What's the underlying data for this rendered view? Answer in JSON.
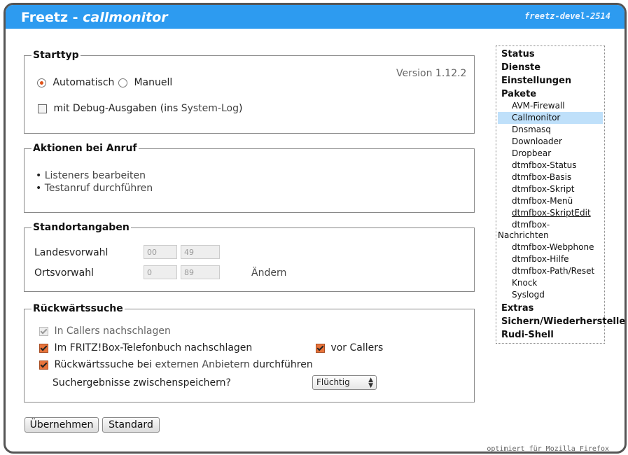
{
  "header": {
    "title_prefix": "Freetz - ",
    "title_page": "callmonitor",
    "build": "freetz-devel-2514"
  },
  "starttyp": {
    "legend": "Starttyp",
    "version": "Version 1.12.2",
    "auto_label": "Automatisch",
    "auto_checked": true,
    "manual_label": "Manuell",
    "manual_checked": false,
    "debug_label_prefix": "mit Debug-Ausgaben (ins ",
    "debug_link": "System-Log",
    "debug_label_suffix": ")",
    "debug_checked": false
  },
  "aktionen": {
    "legend": "Aktionen bei Anruf",
    "items": [
      "Listeners bearbeiten",
      "Testanruf durchführen"
    ]
  },
  "standort": {
    "legend": "Standortangaben",
    "landes_label": "Landesvorwahl",
    "landes_prefix": "00",
    "landes_value": "49",
    "orts_label": "Ortsvorwahl",
    "orts_prefix": "0",
    "orts_value": "89",
    "aendern_label": "Ändern"
  },
  "rueckwaerts": {
    "legend": "Rückwärtssuche",
    "callers_prefix": "In ",
    "callers_link": "Callers",
    "callers_suffix": " nachschlagen",
    "callers_checked": true,
    "callers_disabled": true,
    "fritzbox_label": "Im FRITZ!Box-Telefonbuch nachschlagen",
    "fritzbox_checked": true,
    "vor_callers_label": "vor Callers",
    "vor_callers_checked": true,
    "extern_prefix": "Rückwärtssuche bei ",
    "extern_link": "externen Anbietern",
    "extern_suffix": " durchführen",
    "extern_checked": true,
    "cache_label": "Suchergebnisse zwischenspeichern?",
    "cache_value": "Flüchtig"
  },
  "buttons": {
    "apply": "Übernehmen",
    "default": "Standard"
  },
  "menu": {
    "categories": {
      "status": "Status",
      "dienste": "Dienste",
      "einstellungen": "Einstellungen",
      "pakete": "Pakete",
      "extras": "Extras",
      "sichern": "Sichern/Wiederherstellen",
      "rudi": "Rudi-Shell"
    },
    "packages": [
      "AVM-Firewall",
      "Callmonitor",
      "Dnsmasq",
      "Downloader",
      "Dropbear",
      "dtmfbox-Status",
      "dtmfbox-Basis",
      "dtmfbox-Skript",
      "dtmfbox-Menü",
      "dtmfbox-SkriptEdit",
      "dtmfbox-",
      "Nachrichten",
      "dtmfbox-Webphone",
      "dtmfbox-Hilfe",
      "dtmfbox-Path/Reset",
      "Knock",
      "Syslogd"
    ],
    "selected": "Callmonitor"
  },
  "footer": "optimiert für Mozilla Firefox",
  "colors": {
    "header": "#2d9bf0",
    "selected_menu": "#bfe0fa",
    "checkbox_accent": "#e8733a"
  }
}
